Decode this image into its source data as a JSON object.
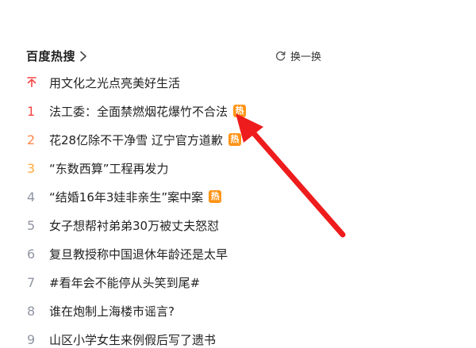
{
  "header": {
    "title": "百度热搜",
    "refresh_label": "换一换"
  },
  "items": [
    {
      "rank": "",
      "pinned": true,
      "text": "用文化之光点亮美好生活",
      "badge": ""
    },
    {
      "rank": "1",
      "text": "法工委：全面禁燃烟花爆竹不合法",
      "badge": "热"
    },
    {
      "rank": "2",
      "text": "花28亿除不干净雪 辽宁官方道歉",
      "badge": "热"
    },
    {
      "rank": "3",
      "text": "“东数西算”工程再发力",
      "badge": ""
    },
    {
      "rank": "4",
      "text": "“结婚16年3娃非亲生”案中案",
      "badge": "热"
    },
    {
      "rank": "5",
      "text": "女子想帮衬弟弟30万被丈夫怒怼",
      "badge": ""
    },
    {
      "rank": "6",
      "text": "复旦教授称中国退休年龄还是太早",
      "badge": ""
    },
    {
      "rank": "7",
      "text": "#看年会不能停从头笑到尾#",
      "badge": ""
    },
    {
      "rank": "8",
      "text": "谁在炮制上海楼市谣言?",
      "badge": ""
    },
    {
      "rank": "9",
      "text": "山区小学女生来例假后写了遗书",
      "badge": ""
    }
  ],
  "colors": {
    "rank_1": "#f54545",
    "rank_2": "#ff8547",
    "rank_3": "#ffac38",
    "rank_other": "#9195a3",
    "pin": "#f54545",
    "hot_badge": "#ff9416",
    "annotation_arrow": "#ee1c1c"
  }
}
